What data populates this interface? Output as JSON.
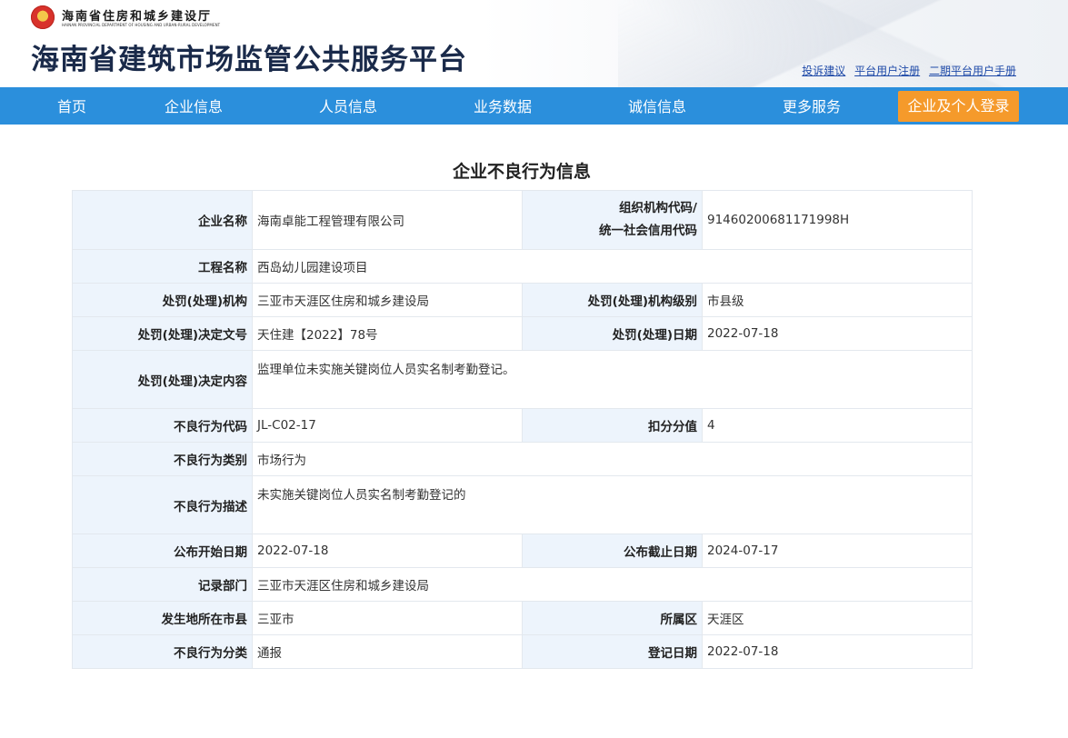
{
  "header": {
    "department_cn": "海南省住房和城乡建设厅",
    "department_en": "HAINAN PROVINCIAL DEPARTMENT OF HOUSING AND URBAN-RURAL DEVELOPMENT",
    "site_title": "海南省建筑市场监管公共服务平台",
    "links": [
      "投诉建议",
      "平台用户注册",
      "二期平台用户手册"
    ]
  },
  "nav": {
    "items": [
      "首页",
      "企业信息",
      "人员信息",
      "业务数据",
      "诚信信息",
      "更多服务"
    ],
    "login": "企业及个人登录"
  },
  "page_title": "企业不良行为信息",
  "fields": {
    "company_name_label": "企业名称",
    "company_name": "海南卓能工程管理有限公司",
    "org_code_label_1": "组织机构代码/",
    "org_code_label_2": "统一社会信用代码",
    "org_code": "91460200681171998H",
    "project_name_label": "工程名称",
    "project_name": "西岛幼儿园建设项目",
    "penalty_org_label": "处罚(处理)机构",
    "penalty_org": "三亚市天涯区住房和城乡建设局",
    "penalty_org_level_label": "处罚(处理)机构级别",
    "penalty_org_level": "市县级",
    "decision_no_label": "处罚(处理)决定文号",
    "decision_no": "天住建【2022】78号",
    "penalty_date_label": "处罚(处理)日期",
    "penalty_date": "2022-07-18",
    "decision_content_label": "处罚(处理)决定内容",
    "decision_content": "监理单位未实施关键岗位人员实名制考勤登记。",
    "behavior_code_label": "不良行为代码",
    "behavior_code": "JL-C02-17",
    "deduct_score_label": "扣分分值",
    "deduct_score": "4",
    "behavior_category_label": "不良行为类别",
    "behavior_category": "市场行为",
    "behavior_desc_label": "不良行为描述",
    "behavior_desc": "未实施关键岗位人员实名制考勤登记的",
    "publish_start_label": "公布开始日期",
    "publish_start": "2022-07-18",
    "publish_end_label": "公布截止日期",
    "publish_end": "2024-07-17",
    "record_dept_label": "记录部门",
    "record_dept": "三亚市天涯区住房和城乡建设局",
    "city_label": "发生地所在市县",
    "city": "三亚市",
    "district_label": "所属区",
    "district": "天涯区",
    "classification_label": "不良行为分类",
    "classification": "通报",
    "register_date_label": "登记日期",
    "register_date": "2022-07-18"
  }
}
